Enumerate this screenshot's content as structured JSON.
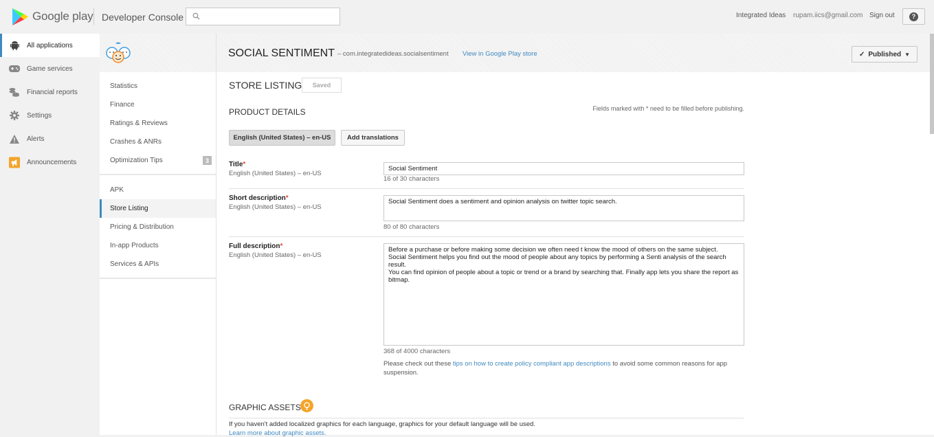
{
  "header": {
    "brand": "Google play",
    "console": "Developer Console",
    "search_placeholder": "",
    "account_name": "Integrated Ideas",
    "email": "rupam.iics@gmail.com",
    "sign_out": "Sign out",
    "help": "?"
  },
  "leftnav": {
    "items": [
      {
        "label": "All applications",
        "icon": "android-icon"
      },
      {
        "label": "Game services",
        "icon": "gamepad-icon"
      },
      {
        "label": "Financial reports",
        "icon": "coins-icon"
      },
      {
        "label": "Settings",
        "icon": "gear-icon"
      },
      {
        "label": "Alerts",
        "icon": "warning-icon"
      },
      {
        "label": "Announcements",
        "icon": "megaphone-icon"
      }
    ]
  },
  "app": {
    "title": "SOCIAL SENTIMENT",
    "package": "– com.integratedideas.socialsentiment",
    "view_link": "View in Google Play store",
    "status": "Published"
  },
  "subnav": {
    "group1": [
      {
        "label": "Statistics"
      },
      {
        "label": "Finance"
      },
      {
        "label": "Ratings & Reviews"
      },
      {
        "label": "Crashes & ANRs"
      },
      {
        "label": "Optimization Tips",
        "badge": "3"
      }
    ],
    "group2": [
      {
        "label": "APK"
      },
      {
        "label": "Store Listing"
      },
      {
        "label": "Pricing & Distribution"
      },
      {
        "label": "In-app Products"
      },
      {
        "label": "Services & APIs"
      }
    ]
  },
  "main": {
    "store_listing": "STORE LISTING",
    "saved": "Saved",
    "product_details": "PRODUCT DETAILS",
    "required_note": "Fields marked with * need to be filled before publishing.",
    "lang_selected": "English (United States) – en-US",
    "add_translations": "Add translations",
    "title_label": "Title",
    "title_sub": "English (United States) – en-US",
    "title_value": "Social Sentiment",
    "title_count": "16 of 30 characters",
    "short_label": "Short description",
    "short_sub": "English (United States) – en-US",
    "short_value": "Social Sentiment does a sentiment and opinion analysis on  twitter topic search.",
    "short_count": "80 of 80 characters",
    "full_label": "Full description",
    "full_sub": "English (United States) – en-US",
    "full_value_1": "Before a purchase or before making some decision we often need t know the mood of others on the same subject.",
    "full_value_2": "Social Sentiment helps you find out the mood of people about any topics by performing a Senti analysis of the search result.",
    "full_value_3": "You can find opinion of people about a topic or trend or a brand by searching that. Finally app lets you share the report as bitmap.",
    "full_count": "368 of 4000 characters",
    "policy_pre": "Please check out these ",
    "policy_link": "tips on how to create policy compliant app descriptions",
    "policy_post": " to avoid some common reasons for app suspension.",
    "graphic_assets": "GRAPHIC ASSETS",
    "graphic_note": "If you haven't added localized graphics for each language, graphics for your default language will be used.",
    "graphic_link": "Learn more about graphic assets."
  }
}
